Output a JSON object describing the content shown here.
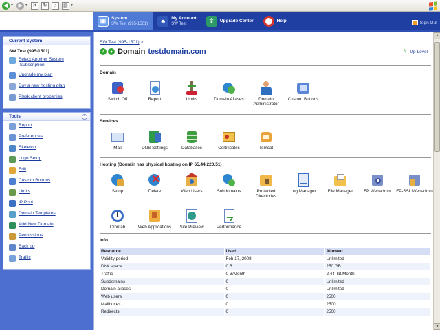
{
  "colors": {
    "nav_bg": "#1f3fa3",
    "nav_active": "#4e7ad6",
    "sidebar_bg": "#4c6fd0",
    "link": "#1b3b9e",
    "status_green": "#31a52f"
  },
  "nav": {
    "tabs": [
      {
        "title": "System",
        "sub": "SW Test (995-1501)",
        "icon": "system-icon"
      },
      {
        "title": "My Account",
        "sub": "SW Test",
        "icon": "account-icon"
      },
      {
        "title": "Upgrade Center",
        "sub": "",
        "icon": "upgrade-icon"
      },
      {
        "title": "Help",
        "sub": "",
        "icon": "help-icon"
      }
    ],
    "sign_out": "Sign Out"
  },
  "sidebar": {
    "current_system": {
      "title": "Current System",
      "name": "SW Test (995-1501)",
      "items": [
        {
          "label": "Select Another System [Subscription]",
          "icon": "select-system-icon"
        },
        {
          "label": "Upgrade my plan",
          "icon": "upgrade-plan-icon"
        },
        {
          "label": "Buy a new hosting plan",
          "icon": "buy-plan-icon"
        },
        {
          "label": "Plesk client properties",
          "icon": "properties-icon"
        }
      ]
    },
    "tools": {
      "title": "Tools",
      "items": [
        {
          "label": "Report",
          "icon": "report-icon"
        },
        {
          "label": "Preferences",
          "icon": "preferences-icon"
        },
        {
          "label": "Skeleton",
          "icon": "skeleton-icon"
        },
        {
          "label": "Logo Setup",
          "icon": "logo-setup-icon"
        },
        {
          "label": "Edit",
          "icon": "edit-icon"
        },
        {
          "label": "Custom Buttons",
          "icon": "custom-buttons-icon"
        },
        {
          "label": "Limits",
          "icon": "limits-icon"
        },
        {
          "label": "IP Pool",
          "icon": "ip-pool-icon"
        },
        {
          "label": "Domain Templates",
          "icon": "domain-templates-icon"
        },
        {
          "label": "Add New Domain",
          "icon": "add-domain-icon"
        },
        {
          "label": "Permissions",
          "icon": "permissions-icon"
        },
        {
          "label": "Back up",
          "icon": "backup-icon"
        },
        {
          "label": "Traffic",
          "icon": "traffic-icon"
        }
      ]
    }
  },
  "main": {
    "breadcrumb": "SW Test (995-1501)",
    "breadcrumb_sep": ">",
    "title": "Domain",
    "domain": "testdomain.com",
    "up_level": "Up Level",
    "domain_section": {
      "title": "Domain",
      "tools": [
        {
          "label": "Switch Off",
          "icon": "switch-off-icon"
        },
        {
          "label": "Report",
          "icon": "report-icon"
        },
        {
          "label": "Limits",
          "icon": "limits-icon"
        },
        {
          "label": "Domain Aliases",
          "icon": "domain-aliases-icon"
        },
        {
          "label": "Domain Administrator",
          "icon": "domain-admin-icon"
        },
        {
          "label": "Custom Buttons",
          "icon": "custom-buttons-icon"
        }
      ]
    },
    "services_section": {
      "title": "Services",
      "tools": [
        {
          "label": "Mail",
          "icon": "mail-icon"
        },
        {
          "label": "DNS Settings",
          "icon": "dns-icon"
        },
        {
          "label": "Databases",
          "icon": "databases-icon"
        },
        {
          "label": "Certificates",
          "icon": "certificates-icon"
        },
        {
          "label": "Tomcat",
          "icon": "tomcat-icon"
        }
      ]
    },
    "hosting_section": {
      "title": "Hosting (Domain has physical hosting on IP 65.44.220.51)",
      "tools": [
        {
          "label": "Setup",
          "icon": "setup-icon"
        },
        {
          "label": "Delete",
          "icon": "delete-icon"
        },
        {
          "label": "Web Users",
          "icon": "web-users-icon"
        },
        {
          "label": "Subdomains",
          "icon": "subdomains-icon"
        },
        {
          "label": "Protected Directories",
          "icon": "protected-dirs-icon"
        },
        {
          "label": "Log Manager",
          "icon": "log-manager-icon"
        },
        {
          "label": "File Manager",
          "icon": "file-manager-icon"
        },
        {
          "label": "FP Webadmin",
          "icon": "fp-webadmin-icon"
        },
        {
          "label": "FP-SSL Webadmin",
          "icon": "fp-ssl-webadmin-icon"
        },
        {
          "label": "Crontab",
          "icon": "crontab-icon"
        },
        {
          "label": "Web Applications",
          "icon": "web-apps-icon"
        },
        {
          "label": "Site Preview",
          "icon": "site-preview-icon"
        },
        {
          "label": "Performance",
          "icon": "performance-icon"
        }
      ]
    },
    "info": {
      "title": "Info",
      "headers": [
        "Resource",
        "Used",
        "Allowed"
      ],
      "rows": [
        [
          "Validity period",
          "Feb 17, 2008",
          "Unlimited"
        ],
        [
          "Disk space",
          "0 B",
          "250 GB"
        ],
        [
          "Traffic",
          "0 B/Month",
          "2.44 TB/Month"
        ],
        [
          "Subdomains",
          "0",
          "Unlimited"
        ],
        [
          "Domain aliases",
          "0",
          "Unlimited"
        ],
        [
          "Web users",
          "0",
          "2500"
        ],
        [
          "Mailboxes",
          "0",
          "2500"
        ],
        [
          "Redirects",
          "0",
          "2500"
        ]
      ]
    }
  }
}
